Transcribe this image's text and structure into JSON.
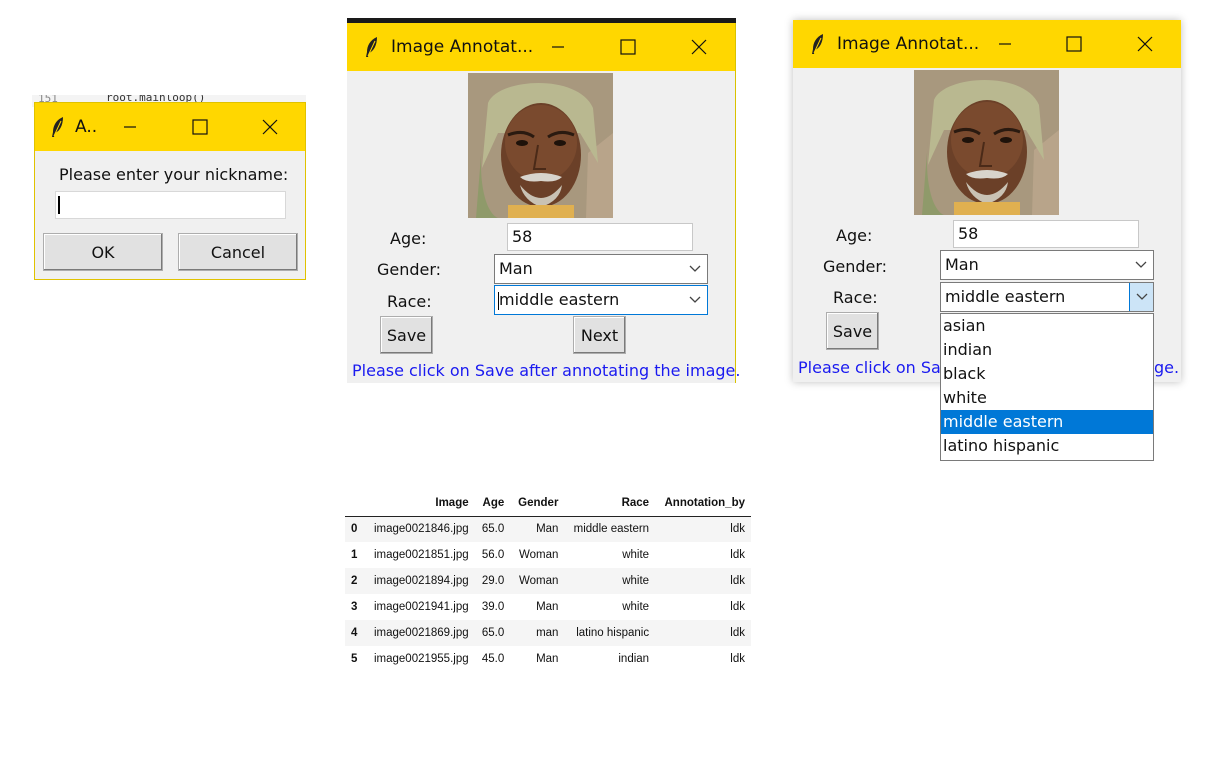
{
  "nick_dialog": {
    "title": "A..",
    "prompt": "Please enter your nickname:",
    "input_value": "",
    "ok_label": "OK",
    "cancel_label": "Cancel",
    "code_line_number": "151",
    "code_snippet": "root.mainloop()"
  },
  "annot_window_1": {
    "title": "Image Annotat...",
    "age_label": "Age:",
    "age_value": "58",
    "gender_label": "Gender:",
    "gender_value": "Man",
    "race_label": "Race:",
    "race_value": "middle eastern",
    "save_label": "Save",
    "next_label": "Next",
    "status_text": "Please click on Save after annotating the image."
  },
  "annot_window_2": {
    "title": "Image Annotat...",
    "age_label": "Age:",
    "age_value": "58",
    "gender_label": "Gender:",
    "gender_value": "Man",
    "race_label": "Race:",
    "race_value": "middle eastern",
    "save_label": "Save",
    "status_left": "Please click on Sa",
    "status_right": "ge.",
    "race_options": [
      "asian",
      "indian",
      "black",
      "white",
      "middle eastern",
      "latino hispanic"
    ],
    "selected_option": "middle eastern"
  },
  "table": {
    "headers": [
      "",
      "Image",
      "Age",
      "Gender",
      "Race",
      "Annotation_by"
    ],
    "rows": [
      [
        "0",
        "image0021846.jpg",
        "65.0",
        "Man",
        "middle eastern",
        "ldk"
      ],
      [
        "1",
        "image0021851.jpg",
        "56.0",
        "Woman",
        "white",
        "ldk"
      ],
      [
        "2",
        "image0021894.jpg",
        "29.0",
        "Woman",
        "white",
        "ldk"
      ],
      [
        "3",
        "image0021941.jpg",
        "39.0",
        "Man",
        "white",
        "ldk"
      ],
      [
        "4",
        "image0021869.jpg",
        "65.0",
        "man",
        "latino hispanic",
        "ldk"
      ],
      [
        "5",
        "image0021955.jpg",
        "45.0",
        "Man",
        "indian",
        "ldk"
      ]
    ]
  },
  "colors": {
    "titlebar": "#ffd700",
    "status_text": "#1a1af0",
    "selection": "#0078d7"
  },
  "icons": [
    "feather-icon",
    "minimize-icon",
    "maximize-icon",
    "close-icon",
    "chevron-down-icon"
  ]
}
